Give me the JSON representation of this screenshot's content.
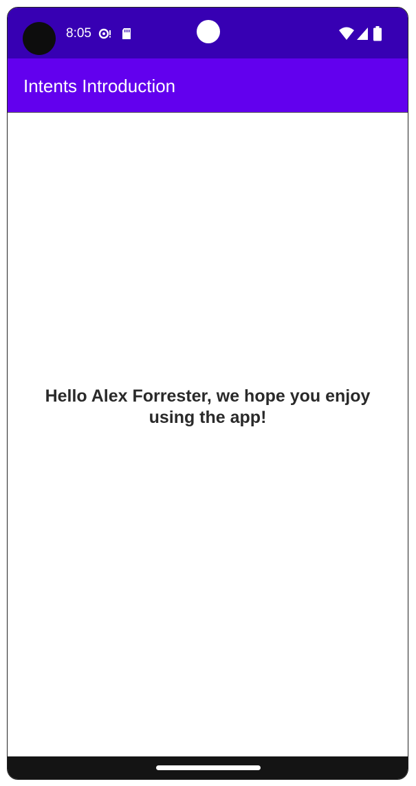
{
  "status_bar": {
    "time": "8:05",
    "background": "#3700b3",
    "icons": [
      "camera-hole",
      "sync-alert-icon",
      "sd-card-icon",
      "wifi-icon",
      "cell-signal-icon",
      "battery-icon"
    ]
  },
  "app_bar": {
    "title": "Intents Introduction",
    "background": "#6200ee",
    "text_color": "#ffffff"
  },
  "main": {
    "welcome_message": "Hello Alex Forrester, we hope you enjoy using the app!"
  },
  "nav_bar": {
    "background": "#141414",
    "handle": "gesture-home-handle"
  }
}
